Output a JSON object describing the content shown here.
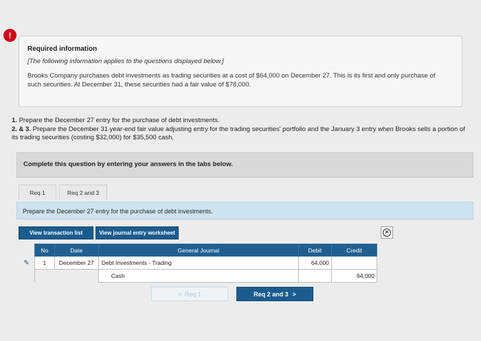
{
  "alert": {
    "symbol": "!"
  },
  "info": {
    "title": "Required information",
    "note": "[The following information applies to the questions displayed below.]",
    "body": "Brooks Company purchases debt investments as trading securities at a cost of $64,000 on December 27. This is its first and only purchase of such securities. At December 31, these securities had a fair value of $78,000."
  },
  "instructions": {
    "item1_num": "1.",
    "item1_text": " Prepare the December 27 entry for the purchase of debt investments.",
    "item2_num": "2. & 3.",
    "item2_text": " Prepare the December 31 year-end fair value adjusting entry for the trading securities' portfolio and the January 3 entry when Brooks sells a portion of its trading securities (costing $32,000) for $35,500 cash."
  },
  "complete_bar": {
    "label": "Complete this question by entering your answers in the tabs below."
  },
  "tabs": [
    {
      "label": "Req 1"
    },
    {
      "label": "Req 2 and 3"
    }
  ],
  "prompt": {
    "text": "Prepare the December 27 entry for the purchase of debt investments."
  },
  "buttons": {
    "view_list": "View transaction list",
    "view_worksheet": "View journal entry worksheet"
  },
  "journal": {
    "headers": {
      "no": "No",
      "date": "Date",
      "general_journal": "General Journal",
      "debit": "Debit",
      "credit": "Credit"
    },
    "rows": [
      {
        "no": "1",
        "date": "December 27",
        "account": "Debt Investments - Trading",
        "debit": "64,000",
        "credit": ""
      },
      {
        "no": "",
        "date": "",
        "account": "Cash",
        "debit": "",
        "credit": "64,000"
      }
    ]
  },
  "nav": {
    "prev_label": "Req 1",
    "next_label": "Req 2 and 3"
  },
  "colors": {
    "accent": "#1b5c8f",
    "alert": "#d0021b",
    "prompt_bg": "#cde3ef"
  }
}
